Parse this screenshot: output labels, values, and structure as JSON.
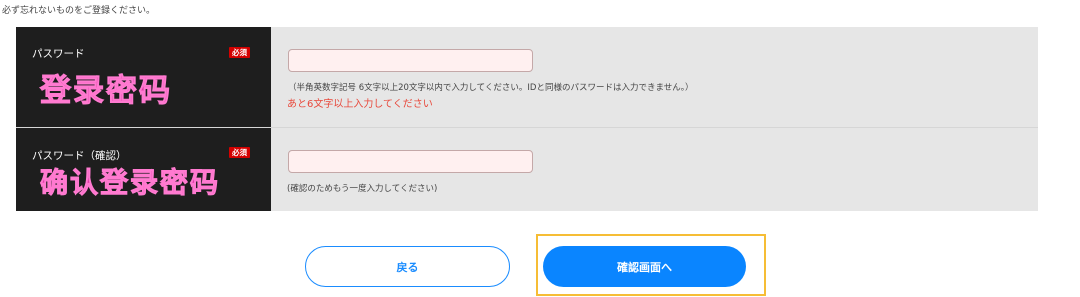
{
  "note": "必ず忘れないものをご登録ください。",
  "password": {
    "label": "パスワード",
    "required_badge": "必須",
    "overlay_text": "登录密码",
    "input_value": "",
    "hint": "（半角英数字記号 6文字以上20文字以内で入力してください。IDと同様のパスワードは入力できません。）",
    "error": "あと6文字以上入力してください"
  },
  "password_confirm": {
    "label": "パスワード（確認）",
    "required_badge": "必須",
    "overlay_text": "确认登录密码",
    "input_value": "",
    "hint": "(確認のためもう一度入力してください)"
  },
  "buttons": {
    "back": "戻る",
    "confirm": "確認画面へ"
  },
  "colors": {
    "label_bg": "#1e1e1e",
    "field_bg": "#e6e6e6",
    "required": "#d40000",
    "error": "#e8493c",
    "primary": "#0a85ff",
    "highlight": "#f6bd35",
    "overlay": "#e23aa8"
  }
}
